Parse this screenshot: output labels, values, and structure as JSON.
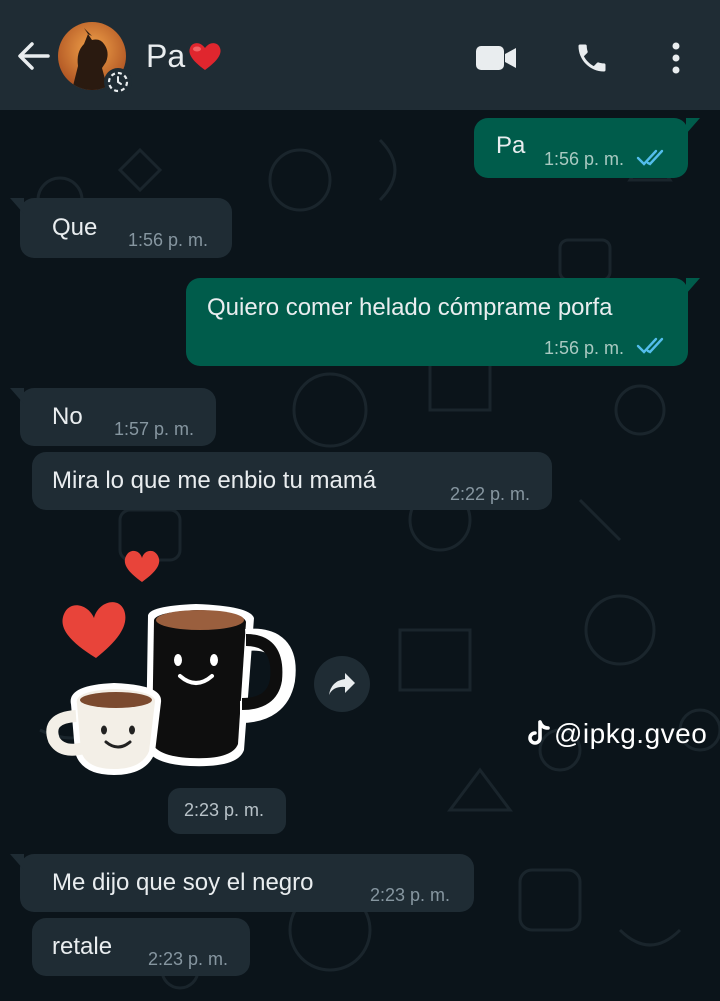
{
  "header": {
    "contact_name": "Pa",
    "back_icon": "arrow-left-icon",
    "video_icon": "video-camera-icon",
    "call_icon": "phone-icon",
    "menu_icon": "more-vert-icon",
    "status_icon": "status-ring-icon"
  },
  "messages": [
    {
      "dir": "out",
      "text": "Pa",
      "time": "1:56 p. m.",
      "read": true
    },
    {
      "dir": "in",
      "text": "Que",
      "time": "1:56 p. m."
    },
    {
      "dir": "out",
      "text": "Quiero comer helado cómprame porfa",
      "time": "1:56 p. m.",
      "read": true
    },
    {
      "dir": "in",
      "text": "No",
      "time": "1:57 p. m."
    },
    {
      "dir": "in",
      "text": "Mira lo que me enbio tu mamá",
      "time": "2:22 p. m."
    },
    {
      "dir": "in",
      "type": "sticker",
      "sticker": "coffee-mugs-love-sticker",
      "time": "2:23 p. m."
    },
    {
      "dir": "in",
      "text": "Me dijo que soy el negro",
      "time": "2:23 p. m."
    },
    {
      "dir": "in",
      "text": "retale",
      "time": "2:23 p. m."
    }
  ],
  "watermark": "@ipkg.gveo",
  "colors": {
    "background": "#0b141a",
    "header": "#1f2c34",
    "incoming": "#1f2c34",
    "outgoing": "#005c4b",
    "read_ticks": "#53bdeb",
    "heart": "#e8443a"
  }
}
